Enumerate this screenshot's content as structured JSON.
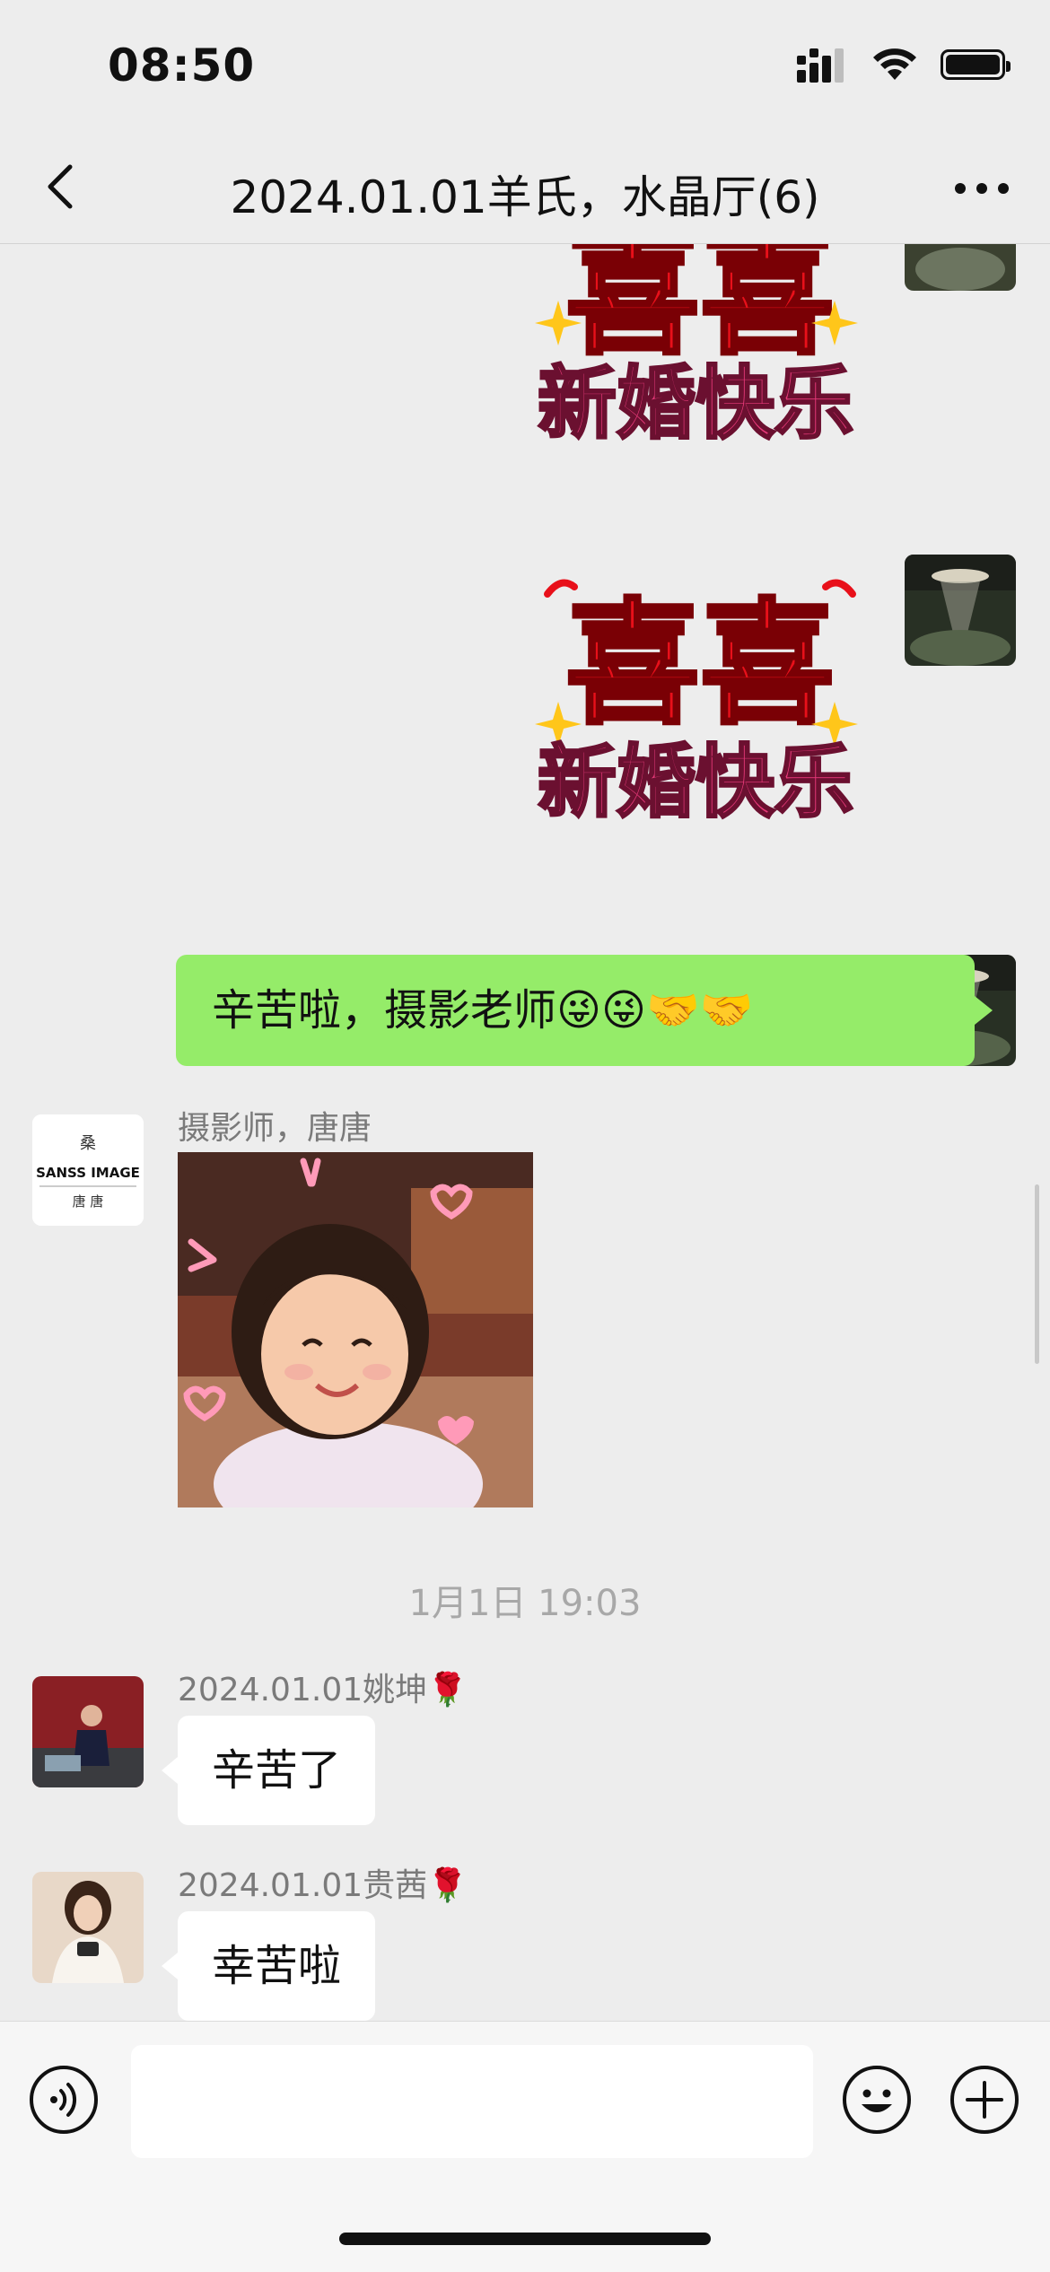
{
  "status_bar": {
    "time": "08:50"
  },
  "header": {
    "title": "2024.01.01羊氏，水晶厅(6)"
  },
  "messages": {
    "sticker_1": {
      "top_text": "喜喜",
      "bottom_text": "新婚快乐"
    },
    "sticker_2": {
      "top_text": "喜喜",
      "bottom_text": "新婚快乐"
    },
    "outgoing_text": "辛苦啦，摄影老师😜😜🤝🤝",
    "photographer": {
      "sender": "摄影师，唐唐",
      "avatar_brand": "SANSS IMAGE",
      "avatar_subtitle": "唐 唐"
    },
    "timestamp": "1月1日 19:03",
    "msg_yao": {
      "sender": "2024.01.01姚坤🌹",
      "text": "辛苦了"
    },
    "msg_gui": {
      "sender": "2024.01.01贵茜🌹",
      "text": "幸苦啦"
    }
  },
  "input_bar": {
    "placeholder": ""
  },
  "icons": {
    "back": "chevron-left-icon",
    "more": "more-dots-icon",
    "voice": "voice-icon",
    "emoji": "emoji-icon",
    "plus": "plus-icon"
  },
  "colors": {
    "bubble_green": "#95ec69",
    "sticker_red": "#e8101a"
  }
}
